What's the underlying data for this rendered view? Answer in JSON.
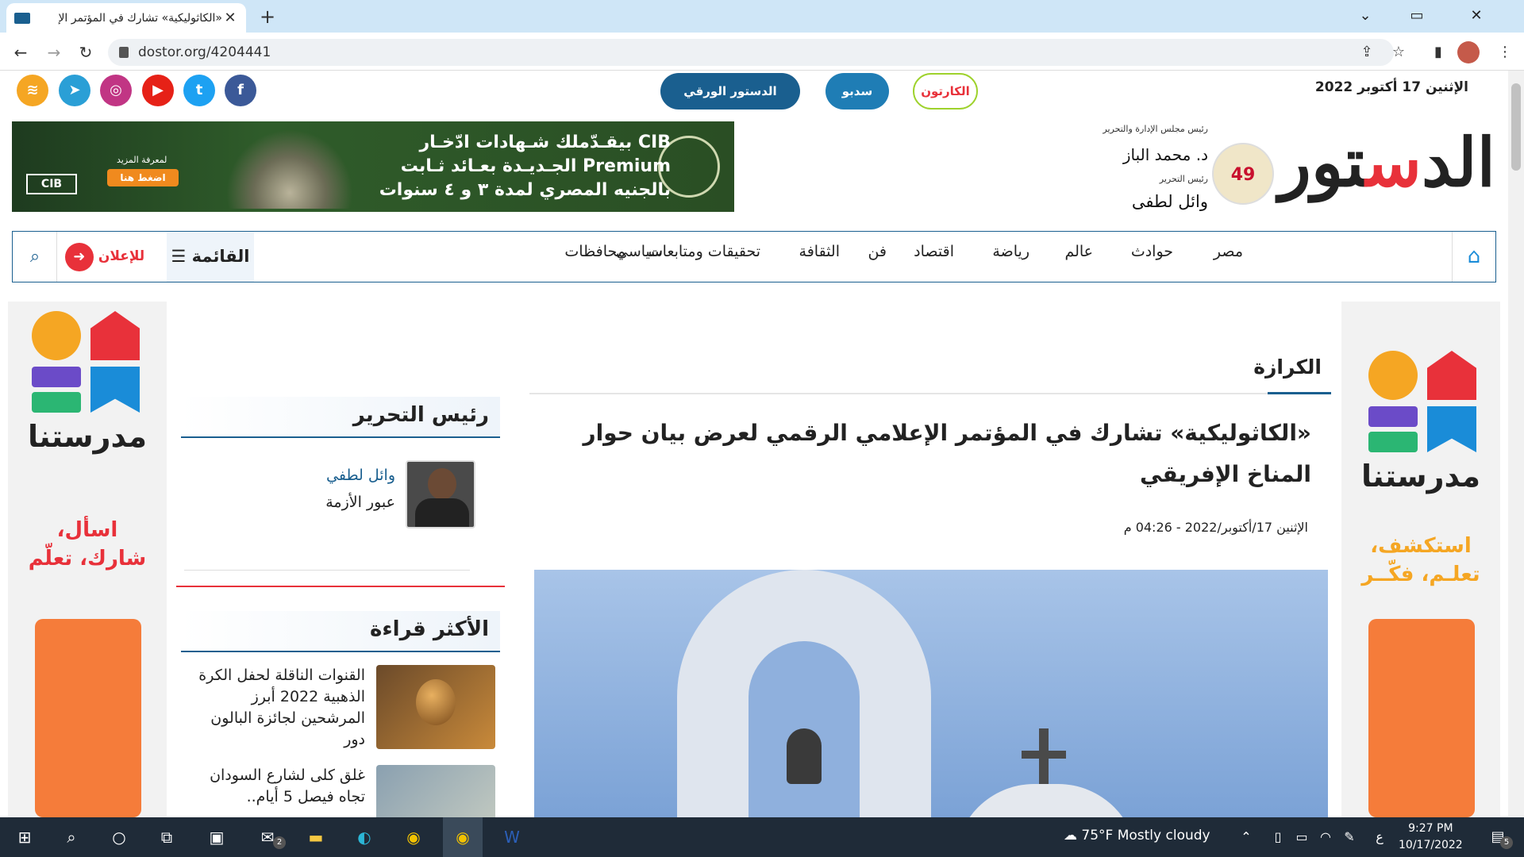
{
  "browser": {
    "tab_title": "«الكاثوليكية» تشارك في المؤتمر الإ",
    "tab_close": "✕",
    "new_tab": "+",
    "url": "dostor.org/4204441",
    "win_min": "⌄",
    "win_max": "▭",
    "win_close": "✕"
  },
  "topstrip": {
    "date": "الإثنين 17 أكتوبر 2022",
    "paper_label": "الدستور الورقي",
    "sadabo_label": "سدبو",
    "karton_label": "الكارتون"
  },
  "social": [
    "facebook-icon",
    "twitter-icon",
    "youtube-icon",
    "instagram-icon",
    "telegram-icon",
    "rss-icon"
  ],
  "header": {
    "logo_black": "الد",
    "logo_red": "س",
    "logo_black2": "تور",
    "badge": "49",
    "chair_label": "رئيس مجلس الإدارة والتحرير",
    "chair_name": "د. محمد الباز",
    "editor_label": "رئيس التحرير",
    "editor_name": "وائل لطفى"
  },
  "ad": {
    "line1": "CIB بيقـدّملك شـهادات ادّخـار",
    "line2": "Premium الجـديـدة بعـائد ثـابت",
    "line3": "بالجنيه المصري لمدة ٣ و ٤ سنوات",
    "more": "لمعرفة المزيد",
    "press": "اضغط هنا",
    "brand": "CIB"
  },
  "menu": {
    "items": [
      "مصر",
      "حوادث",
      "عالم",
      "رياضة",
      "اقتصاد",
      "فن",
      "الثقافة",
      "تحقيقات ومتابعات",
      "محافظات",
      "سياسي"
    ],
    "list_label": "القائمة",
    "ads_label": "للإعلان"
  },
  "sideads": {
    "word": "مدرستنا",
    "left_slogan_1": "اسأل،",
    "left_slogan_2": "شارك، تعلّم",
    "right_slogan_1": "استكشف،",
    "right_slogan_2": "تعلـم، فكّــر",
    "accent_orange": "#f5a623",
    "accent_red": "#e8313a"
  },
  "article": {
    "section": "الكرازة",
    "headline": "«الكاثوليكية» تشارك في المؤتمر الإعلامي الرقمي لعرض بيان حوار المناخ الإفريقي",
    "published": "الإثنين 17/أكتوبر/2022 - 04:26 م"
  },
  "sidebar": {
    "editor_heading": "رئيس التحرير",
    "writer_name": "وائل لطفي",
    "column_title": "عبور الأزمة",
    "popular_heading": "الأكثر قراءة",
    "popular": [
      "القنوات الناقلة لحفل الكرة الذهبية 2022 أبرز المرشحين لجائزة البالون دور",
      "غلق كلى لشارع السودان تجاه فيصل 5 أيام.."
    ]
  },
  "taskbar": {
    "weather": "75°F  Mostly cloudy",
    "time": "9:27 PM",
    "date": "10/17/2022",
    "mail_badge": "2",
    "notif_badge": "5",
    "lang": "ع"
  },
  "colors": {
    "brand_blue": "#1a5f8f",
    "brand_red": "#e8313a",
    "taskbar": "#1f2b38"
  }
}
